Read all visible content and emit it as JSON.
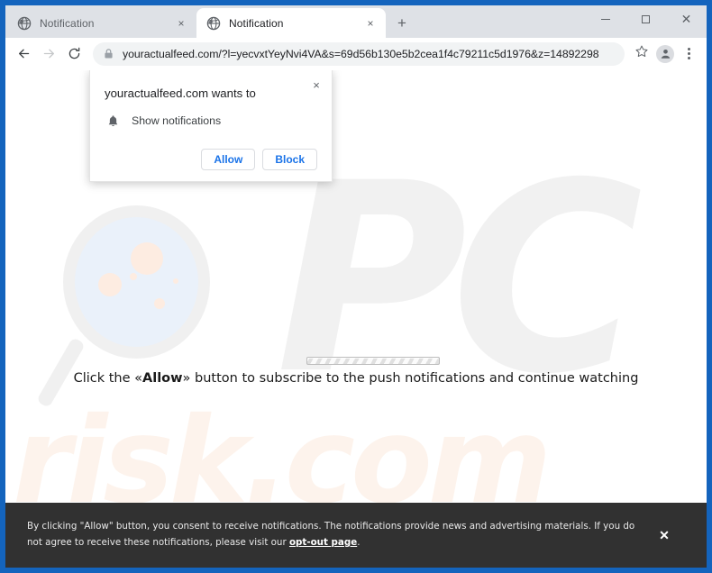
{
  "window": {
    "controls": {
      "minimize": "minimize",
      "maximize": "maximize",
      "close": "close"
    }
  },
  "tabs": {
    "items": [
      {
        "title": "Notification",
        "active": false,
        "close_label": "×",
        "favicon": "globe-icon"
      },
      {
        "title": "Notification",
        "active": true,
        "close_label": "×",
        "favicon": "globe-icon"
      }
    ],
    "new_tab_label": "+"
  },
  "toolbar": {
    "back": "back-arrow-icon",
    "forward": "forward-arrow-icon",
    "reload": "reload-icon",
    "lock": "lock-icon",
    "url": "youractualfeed.com/?l=yecvxtYeyNvi4VA&s=69d56b130e5b2cea1f4c79211c5d1976&z=14892298",
    "bookmark": "star-icon",
    "profile": "avatar-icon",
    "menu": "three-dot-menu-icon"
  },
  "permission_dialog": {
    "title": "youractualfeed.com wants to",
    "permission_label": "Show notifications",
    "permission_icon": "bell-icon",
    "allow_label": "Allow",
    "block_label": "Block",
    "close_label": "×"
  },
  "page": {
    "instruction_prefix": "Click the «Allow»",
    "instruction_bold": "Allow",
    "instruction_before_bold": "Click the «",
    "instruction_after_bold": "» button to subscribe to the push notifications and continue watching",
    "watermark_pc": "PC",
    "watermark_risk": "risk.com",
    "loading_bar": "indeterminate-progress-bar"
  },
  "consent_banner": {
    "text_part1": "By clicking \"Allow\" button, you consent to receive notifications. The notifications provide news and advertising materials. If you do not agree to receive these notifications, please visit our ",
    "link_label": "opt-out page",
    "text_part2": ".",
    "close_label": "✕"
  },
  "colors": {
    "window_frame": "#1464bd",
    "tab_strip": "#dee1e6",
    "accent_blue": "#1a73e8",
    "banner_bg": "#313131",
    "watermark_pc": "#f1f1f1",
    "watermark_risk": "#fdf3ec"
  }
}
